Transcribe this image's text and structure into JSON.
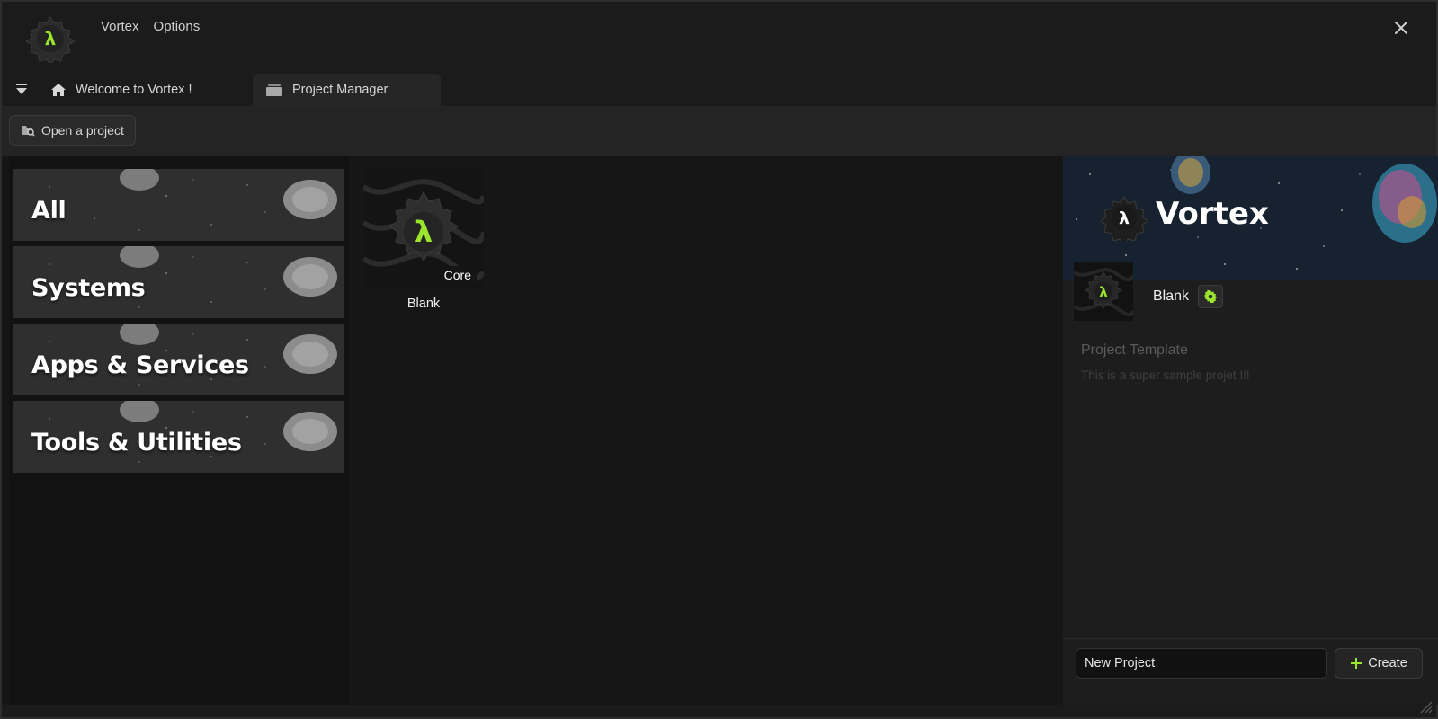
{
  "app": {
    "menu": [
      "Vortex",
      "Options"
    ]
  },
  "tabs": {
    "welcome": "Welcome to Vortex !",
    "project_manager": "Project Manager"
  },
  "toolbar": {
    "open_project": "Open a project"
  },
  "categories": [
    {
      "label": "All"
    },
    {
      "label": "Systems"
    },
    {
      "label": "Apps & Services"
    },
    {
      "label": "Tools & Utilities"
    }
  ],
  "templates": [
    {
      "name": "Blank",
      "badge": "Core"
    }
  ],
  "detail": {
    "banner_title": "Vortex",
    "selected_name": "Blank",
    "desc_title": "Project Template",
    "desc_text": "This is a super sample projet !!!",
    "name_value": "New Project",
    "create_label": "Create"
  },
  "colors": {
    "accent": "#9be52c",
    "background": "#1b1b1b",
    "panel": "#1d1d1d"
  }
}
